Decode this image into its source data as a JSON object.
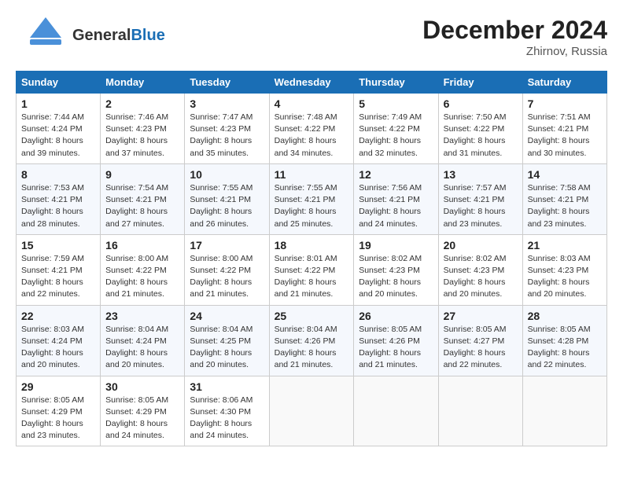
{
  "header": {
    "logo_line1": "General",
    "logo_line2": "Blue",
    "month": "December 2024",
    "location": "Zhirnov, Russia"
  },
  "weekdays": [
    "Sunday",
    "Monday",
    "Tuesday",
    "Wednesday",
    "Thursday",
    "Friday",
    "Saturday"
  ],
  "weeks": [
    [
      {
        "day": "1",
        "sunrise": "7:44 AM",
        "sunset": "4:24 PM",
        "daylight": "8 hours and 39 minutes."
      },
      {
        "day": "2",
        "sunrise": "7:46 AM",
        "sunset": "4:23 PM",
        "daylight": "8 hours and 37 minutes."
      },
      {
        "day": "3",
        "sunrise": "7:47 AM",
        "sunset": "4:23 PM",
        "daylight": "8 hours and 35 minutes."
      },
      {
        "day": "4",
        "sunrise": "7:48 AM",
        "sunset": "4:22 PM",
        "daylight": "8 hours and 34 minutes."
      },
      {
        "day": "5",
        "sunrise": "7:49 AM",
        "sunset": "4:22 PM",
        "daylight": "8 hours and 32 minutes."
      },
      {
        "day": "6",
        "sunrise": "7:50 AM",
        "sunset": "4:22 PM",
        "daylight": "8 hours and 31 minutes."
      },
      {
        "day": "7",
        "sunrise": "7:51 AM",
        "sunset": "4:21 PM",
        "daylight": "8 hours and 30 minutes."
      }
    ],
    [
      {
        "day": "8",
        "sunrise": "7:53 AM",
        "sunset": "4:21 PM",
        "daylight": "8 hours and 28 minutes."
      },
      {
        "day": "9",
        "sunrise": "7:54 AM",
        "sunset": "4:21 PM",
        "daylight": "8 hours and 27 minutes."
      },
      {
        "day": "10",
        "sunrise": "7:55 AM",
        "sunset": "4:21 PM",
        "daylight": "8 hours and 26 minutes."
      },
      {
        "day": "11",
        "sunrise": "7:55 AM",
        "sunset": "4:21 PM",
        "daylight": "8 hours and 25 minutes."
      },
      {
        "day": "12",
        "sunrise": "7:56 AM",
        "sunset": "4:21 PM",
        "daylight": "8 hours and 24 minutes."
      },
      {
        "day": "13",
        "sunrise": "7:57 AM",
        "sunset": "4:21 PM",
        "daylight": "8 hours and 23 minutes."
      },
      {
        "day": "14",
        "sunrise": "7:58 AM",
        "sunset": "4:21 PM",
        "daylight": "8 hours and 23 minutes."
      }
    ],
    [
      {
        "day": "15",
        "sunrise": "7:59 AM",
        "sunset": "4:21 PM",
        "daylight": "8 hours and 22 minutes."
      },
      {
        "day": "16",
        "sunrise": "8:00 AM",
        "sunset": "4:22 PM",
        "daylight": "8 hours and 21 minutes."
      },
      {
        "day": "17",
        "sunrise": "8:00 AM",
        "sunset": "4:22 PM",
        "daylight": "8 hours and 21 minutes."
      },
      {
        "day": "18",
        "sunrise": "8:01 AM",
        "sunset": "4:22 PM",
        "daylight": "8 hours and 21 minutes."
      },
      {
        "day": "19",
        "sunrise": "8:02 AM",
        "sunset": "4:23 PM",
        "daylight": "8 hours and 20 minutes."
      },
      {
        "day": "20",
        "sunrise": "8:02 AM",
        "sunset": "4:23 PM",
        "daylight": "8 hours and 20 minutes."
      },
      {
        "day": "21",
        "sunrise": "8:03 AM",
        "sunset": "4:23 PM",
        "daylight": "8 hours and 20 minutes."
      }
    ],
    [
      {
        "day": "22",
        "sunrise": "8:03 AM",
        "sunset": "4:24 PM",
        "daylight": "8 hours and 20 minutes."
      },
      {
        "day": "23",
        "sunrise": "8:04 AM",
        "sunset": "4:24 PM",
        "daylight": "8 hours and 20 minutes."
      },
      {
        "day": "24",
        "sunrise": "8:04 AM",
        "sunset": "4:25 PM",
        "daylight": "8 hours and 20 minutes."
      },
      {
        "day": "25",
        "sunrise": "8:04 AM",
        "sunset": "4:26 PM",
        "daylight": "8 hours and 21 minutes."
      },
      {
        "day": "26",
        "sunrise": "8:05 AM",
        "sunset": "4:26 PM",
        "daylight": "8 hours and 21 minutes."
      },
      {
        "day": "27",
        "sunrise": "8:05 AM",
        "sunset": "4:27 PM",
        "daylight": "8 hours and 22 minutes."
      },
      {
        "day": "28",
        "sunrise": "8:05 AM",
        "sunset": "4:28 PM",
        "daylight": "8 hours and 22 minutes."
      }
    ],
    [
      {
        "day": "29",
        "sunrise": "8:05 AM",
        "sunset": "4:29 PM",
        "daylight": "8 hours and 23 minutes."
      },
      {
        "day": "30",
        "sunrise": "8:05 AM",
        "sunset": "4:29 PM",
        "daylight": "8 hours and 24 minutes."
      },
      {
        "day": "31",
        "sunrise": "8:06 AM",
        "sunset": "4:30 PM",
        "daylight": "8 hours and 24 minutes."
      },
      null,
      null,
      null,
      null
    ]
  ],
  "labels": {
    "sunrise": "Sunrise:",
    "sunset": "Sunset:",
    "daylight": "Daylight:"
  }
}
